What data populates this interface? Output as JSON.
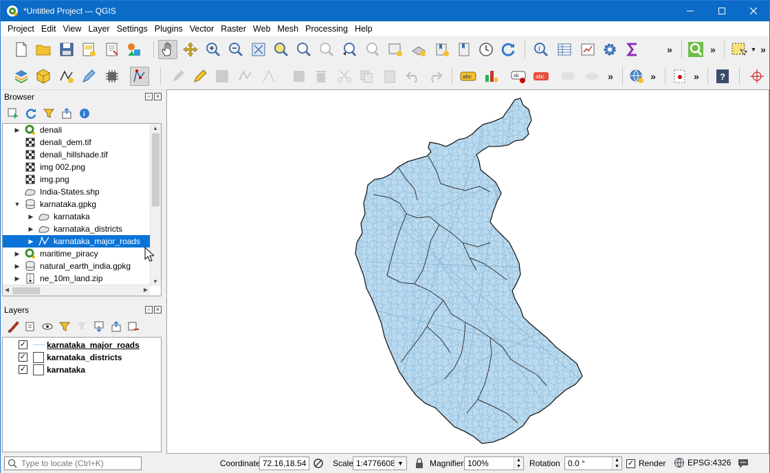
{
  "window": {
    "title": "*Untitled Project — QGIS"
  },
  "menu": [
    "Project",
    "Edit",
    "View",
    "Layer",
    "Settings",
    "Plugins",
    "Vector",
    "Raster",
    "Web",
    "Mesh",
    "Processing",
    "Help"
  ],
  "browser": {
    "title": "Browser",
    "items": [
      {
        "label": "denali",
        "caret": "▶",
        "icon": "qgis-project-icon",
        "indent": 0
      },
      {
        "label": "denali_dem.tif",
        "caret": "",
        "icon": "raster-icon",
        "indent": 0
      },
      {
        "label": "denali_hillshade.tif",
        "caret": "",
        "icon": "raster-icon",
        "indent": 0
      },
      {
        "label": "img 002.png",
        "caret": "",
        "icon": "raster-icon",
        "indent": 0
      },
      {
        "label": "img.png",
        "caret": "",
        "icon": "raster-icon",
        "indent": 0
      },
      {
        "label": "India-States.shp",
        "caret": "",
        "icon": "polygon-icon",
        "indent": 0
      },
      {
        "label": "karnataka.gpkg",
        "caret": "▼",
        "icon": "database-icon",
        "indent": 0
      },
      {
        "label": "karnataka",
        "caret": "▶",
        "icon": "polygon-icon",
        "indent": 1
      },
      {
        "label": "karnataka_districts",
        "caret": "▶",
        "icon": "polygon-icon",
        "indent": 1
      },
      {
        "label": "karnataka_major_roads",
        "caret": "▶",
        "icon": "line-layer-icon",
        "indent": 1
      },
      {
        "label": "maritime_piracy",
        "caret": "▶",
        "icon": "qgis-project-icon",
        "indent": 0
      },
      {
        "label": "natural_earth_india.gpkg",
        "caret": "▶",
        "icon": "database-icon",
        "indent": 0
      },
      {
        "label": "ne_10m_land.zip",
        "caret": "▶",
        "icon": "zip-icon",
        "indent": 0
      }
    ]
  },
  "layers": {
    "title": "Layers",
    "items": [
      {
        "label": "karnataka_major_roads",
        "checked": "✓",
        "symbol": "line"
      },
      {
        "label": "karnataka_districts",
        "checked": "✓",
        "symbol": "fill"
      },
      {
        "label": "karnataka",
        "checked": "✓",
        "symbol": "fill"
      }
    ]
  },
  "status": {
    "locate_placeholder": "Type to locate (Ctrl+K)",
    "coordinate_label": "Coordinate",
    "coordinate_value": "72.16,18.54",
    "scale_label": "Scale",
    "scale_value": "1:4776608",
    "magnifier_label": "Magnifier",
    "magnifier_value": "100%",
    "rotation_label": "Rotation",
    "rotation_value": "0.0 °",
    "render_label": "Render",
    "render_checked": "✓",
    "crs": "EPSG:4326"
  },
  "colors": {
    "titlebar": "#0b6bc6",
    "selection": "#0a73d8",
    "roads": "#a6cde6",
    "district_border": "#222222"
  }
}
